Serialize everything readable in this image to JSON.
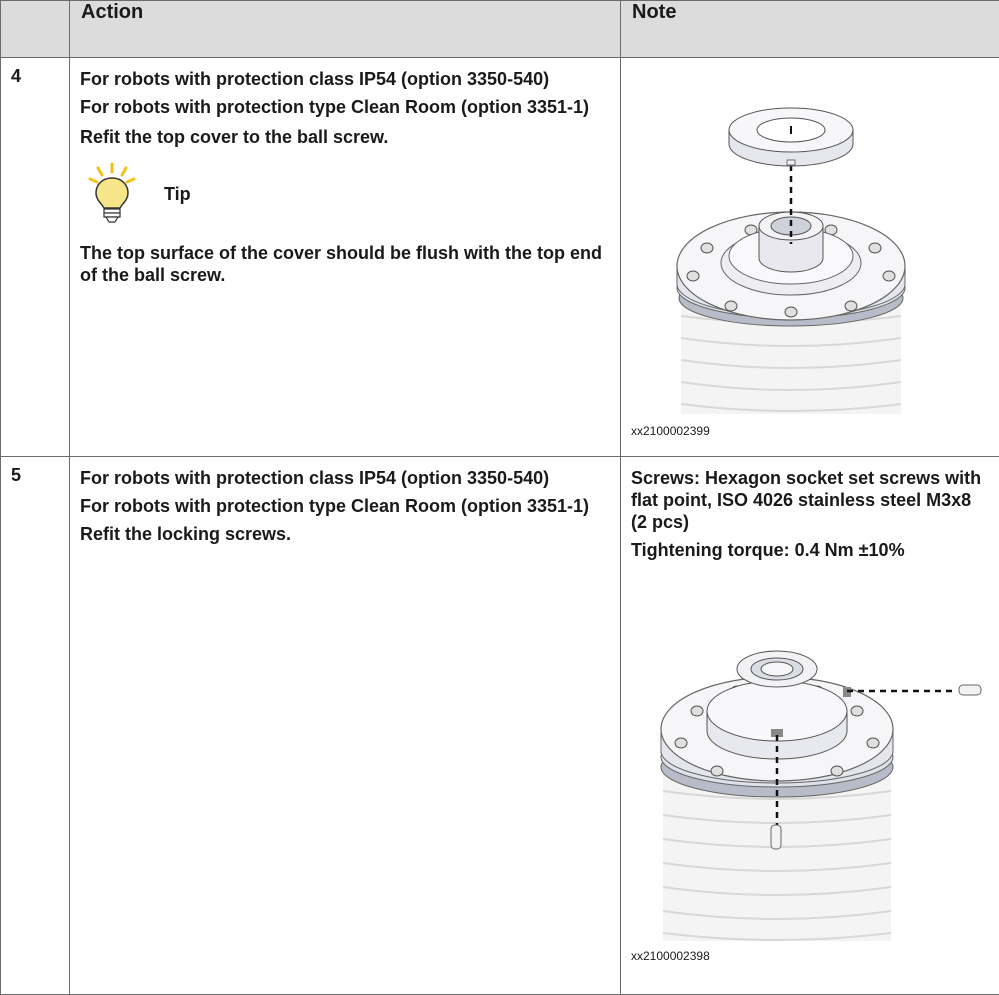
{
  "header": {
    "col_num": "",
    "col_action": "Action",
    "col_note": "Note"
  },
  "steps": [
    {
      "number": "4",
      "action": [
        "For robots with protection class IP54 (option 3350-540)",
        "For robots with protection type Clean Room (option 3351-1)",
        "Refit the top cover to the ball screw."
      ],
      "tip_label": "Tip",
      "tip_text": "The top surface of the cover should be flush with the top end of the ball screw.",
      "note_lines": [],
      "figure_code": "xx2100002399"
    },
    {
      "number": "5",
      "action": [
        "For robots with protection class IP54 (option 3350-540)",
        "For robots with protection type Clean Room (option 3351-1)",
        "Refit the locking screws."
      ],
      "note_lines": [
        "Screws: Hexagon socket set screws with flat point, ISO 4026 stainless steel M3x8 (2 pcs)",
        "Tightening torque: 0.4 Nm ±10%"
      ],
      "figure_code": "xx2100002398"
    }
  ],
  "colors": {
    "header_bg": "#dcdcdc",
    "border": "#6b6b6b",
    "tip_bulb": "#f7d43b"
  },
  "icons": [
    "lightbulb-icon"
  ]
}
